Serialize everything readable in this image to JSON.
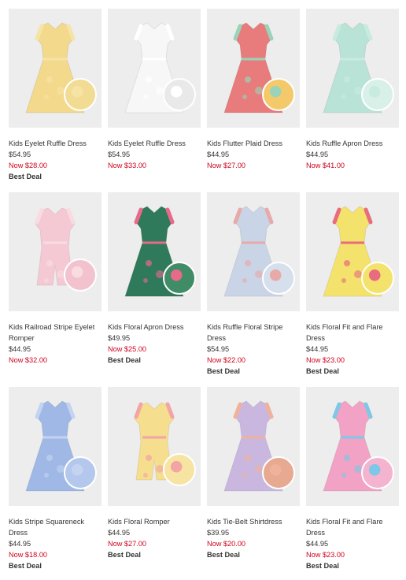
{
  "products": [
    {
      "name": "Kids Eyelet Ruffle Dress",
      "price": "$54.95",
      "sale": "Now $28.00",
      "badge": "Best Deal",
      "image": "yellow-eyelet-dress",
      "colors": {
        "body": "#f3d98b",
        "trim": "#f6e3a6",
        "swatch": "#f2dc93"
      }
    },
    {
      "name": "Kids Eyelet Ruffle Dress",
      "price": "$54.95",
      "sale": "Now $33.00",
      "badge": "",
      "image": "white-eyelet-dress",
      "colors": {
        "body": "#f7f7f7",
        "trim": "#ffffff",
        "swatch": "#e9e9e9"
      }
    },
    {
      "name": "Kids Flutter Plaid Dress",
      "price": "$44.95",
      "sale": "Now $27.00",
      "badge": "",
      "image": "plaid-dress",
      "colors": {
        "body": "#e87b7b",
        "trim": "#9ad3b8",
        "swatch": "#f4c96a"
      }
    },
    {
      "name": "Kids Ruffle Apron Dress",
      "price": "$44.95",
      "sale": "Now $41.00",
      "badge": "",
      "image": "mint-floral-dress",
      "colors": {
        "body": "#b9e3d6",
        "trim": "#c8ebe0",
        "swatch": "#d9f0e8"
      }
    },
    {
      "name": "Kids Railroad Stripe Eyelet Romper",
      "price": "$44.95",
      "sale": "Now $32.00",
      "badge": "",
      "image": "pink-romper",
      "colors": {
        "body": "#f5c9d3",
        "trim": "#f9dbe2",
        "swatch": "#f2c3cf"
      }
    },
    {
      "name": "Kids Floral Apron Dress",
      "price": "$49.95",
      "sale": "Now $25.00",
      "badge": "Best Deal",
      "image": "green-floral-dress",
      "colors": {
        "body": "#2f7a5a",
        "trim": "#e86a8a",
        "swatch": "#3f8c67"
      }
    },
    {
      "name": "Kids Ruffle Floral Stripe Dress",
      "price": "$54.95",
      "sale": "Now $22.00",
      "badge": "Best Deal",
      "image": "stripe-floral-dress",
      "colors": {
        "body": "#c9d5e6",
        "trim": "#e8a9a9",
        "swatch": "#d6dfec"
      }
    },
    {
      "name": "Kids Floral Fit and Flare Dress",
      "price": "$44.95",
      "sale": "Now $23.00",
      "badge": "Best Deal",
      "image": "yellow-floral-dress",
      "colors": {
        "body": "#f3e26b",
        "trim": "#e86b7e",
        "swatch": "#f3e26b"
      }
    },
    {
      "name": "Kids Stripe Squareneck Dress",
      "price": "$44.95",
      "sale": "Now $18.00",
      "badge": "Best Deal",
      "image": "blue-stripe-dress",
      "colors": {
        "body": "#9fb8e6",
        "trim": "#c3d3f0",
        "swatch": "#b4c7ec"
      }
    },
    {
      "name": "Kids Floral Romper",
      "price": "$44.95",
      "sale": "Now $27.00",
      "badge": "Best Deal",
      "image": "yellow-romper",
      "colors": {
        "body": "#f6de8f",
        "trim": "#f3a4a4",
        "swatch": "#f7e4a3"
      }
    },
    {
      "name": "Kids Tie-Belt Shirtdress",
      "price": "$39.95",
      "sale": "Now $20.00",
      "badge": "Best Deal",
      "image": "multistripe-shirtdress",
      "colors": {
        "body": "#c9b7e0",
        "trim": "#f0b29a",
        "swatch": "#e7a98f"
      }
    },
    {
      "name": "Kids Floral Fit and Flare Dress",
      "price": "$44.95",
      "sale": "Now $23.00",
      "badge": "Best Deal",
      "image": "ditsy-floral-dress",
      "colors": {
        "body": "#f2a2c4",
        "trim": "#7fc7e6",
        "swatch": "#f4b3cf"
      }
    }
  ]
}
